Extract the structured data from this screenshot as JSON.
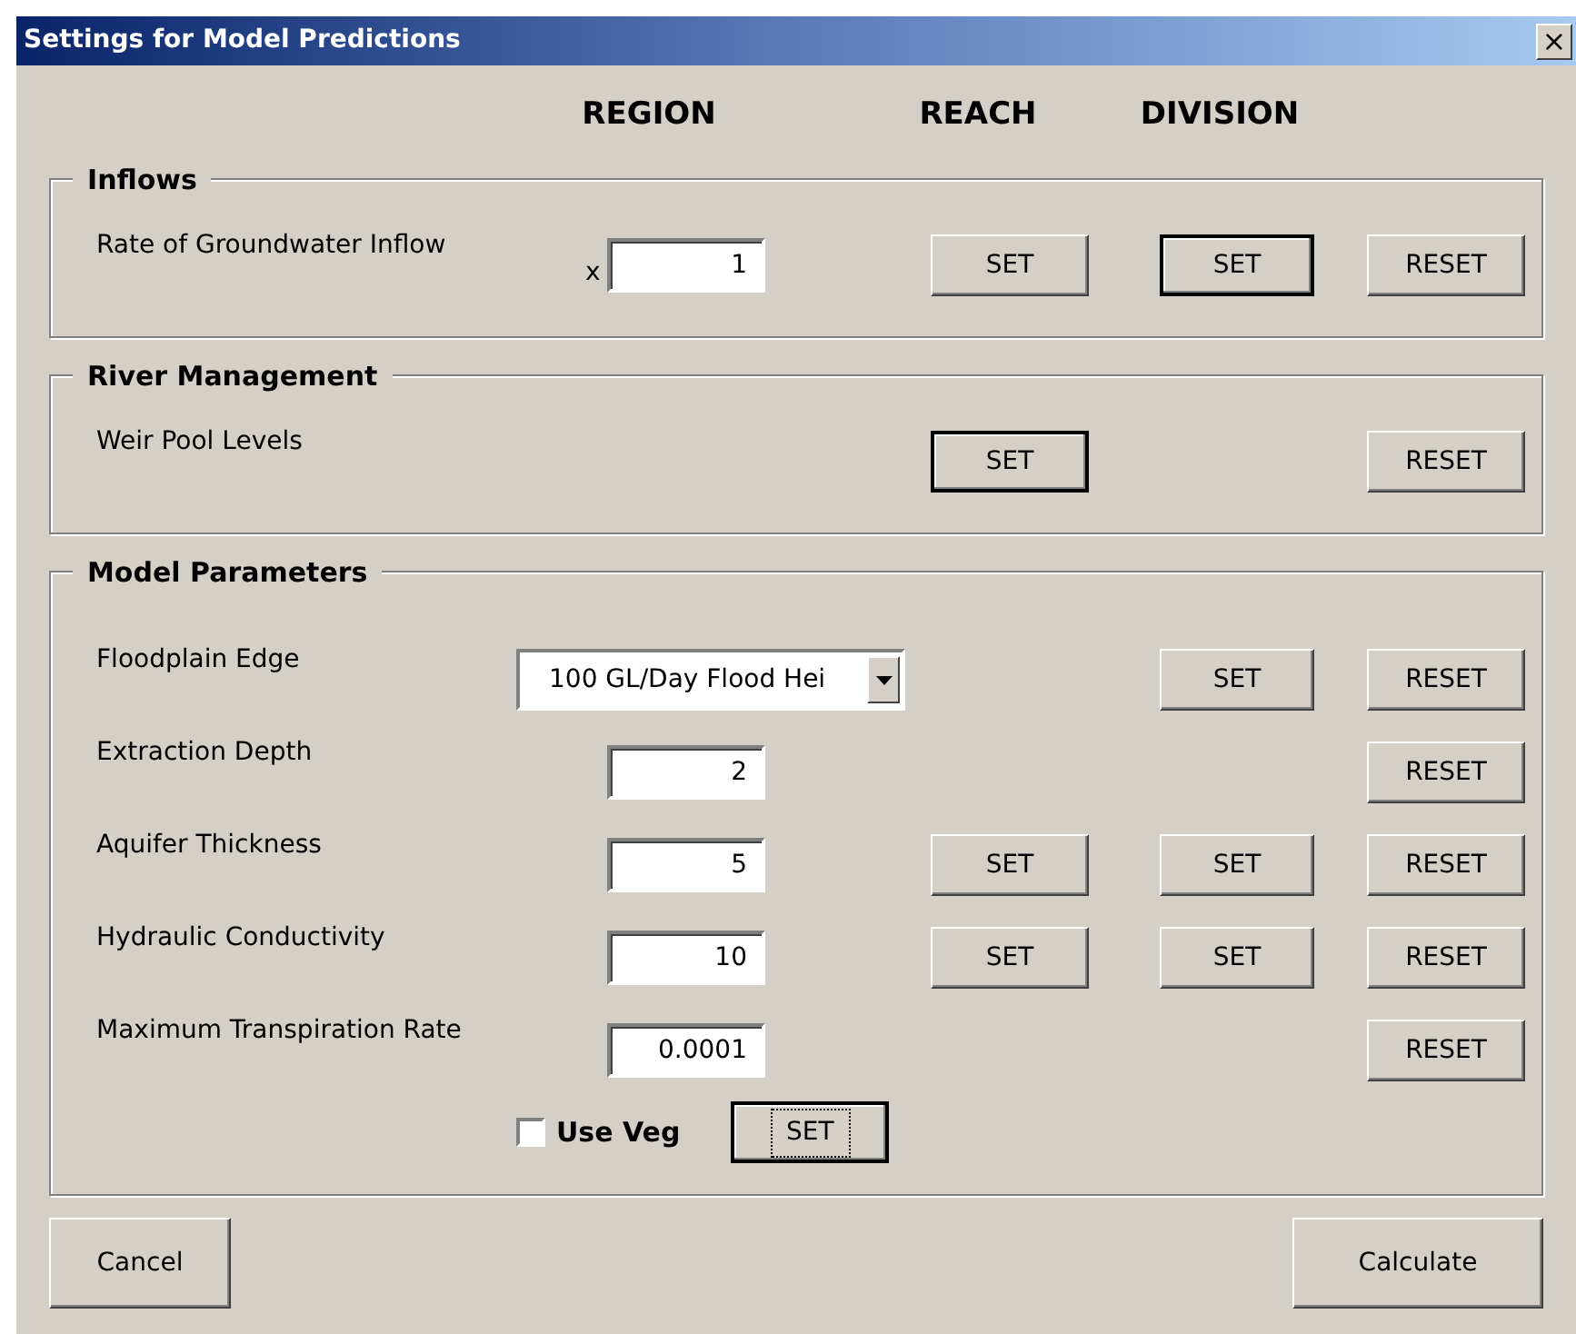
{
  "window": {
    "title": "Settings for Model Predictions",
    "close": "×"
  },
  "headers": [
    "REGION",
    "REACH",
    "DIVISION"
  ],
  "sections": [
    {
      "title": "Inflows",
      "rows": [
        {
          "label": "Rate of Groundwater Inflow",
          "control": {
            "kind": "input",
            "prefix": "x",
            "value": "1"
          },
          "reach": {
            "label": "SET",
            "default": false
          },
          "division": {
            "label": "SET",
            "default": true
          },
          "reset": {
            "label": "RESET",
            "default": false
          }
        }
      ]
    },
    {
      "title": "River Management",
      "rows": [
        {
          "label": "Weir Pool Levels",
          "control": {
            "kind": "none"
          },
          "reach": {
            "label": "SET",
            "default": true
          },
          "reset": {
            "label": "RESET",
            "default": false
          }
        }
      ]
    },
    {
      "title": "Model Parameters",
      "rows": [
        {
          "label": "Floodplain Edge",
          "control": {
            "kind": "dropdown",
            "value": "100 GL/Day Flood Hei"
          },
          "division": {
            "label": "SET",
            "default": false
          },
          "reset": {
            "label": "RESET",
            "default": false
          }
        },
        {
          "label": "Extraction Depth",
          "control": {
            "kind": "input",
            "value": "2"
          },
          "reset": {
            "label": "RESET",
            "default": false
          }
        },
        {
          "label": "Aquifer Thickness",
          "control": {
            "kind": "input",
            "value": "5"
          },
          "reach": {
            "label": "SET",
            "default": false
          },
          "division": {
            "label": "SET",
            "default": false
          },
          "reset": {
            "label": "RESET",
            "default": false
          }
        },
        {
          "label": "Hydraulic Conductivity",
          "control": {
            "kind": "input",
            "value": "10"
          },
          "reach": {
            "label": "SET",
            "default": false
          },
          "division": {
            "label": "SET",
            "default": false
          },
          "reset": {
            "label": "RESET",
            "default": false
          }
        },
        {
          "label": "Maximum Transpiration Rate",
          "control": {
            "kind": "input",
            "value": "0.0001"
          },
          "reset": {
            "label": "RESET",
            "default": false
          }
        }
      ],
      "option": {
        "label": "Use Veg",
        "checked": false,
        "button": {
          "label": "SET",
          "default": true,
          "focused": true
        }
      }
    }
  ],
  "footer": {
    "cancel": "Cancel",
    "calculate": "Calculate"
  }
}
